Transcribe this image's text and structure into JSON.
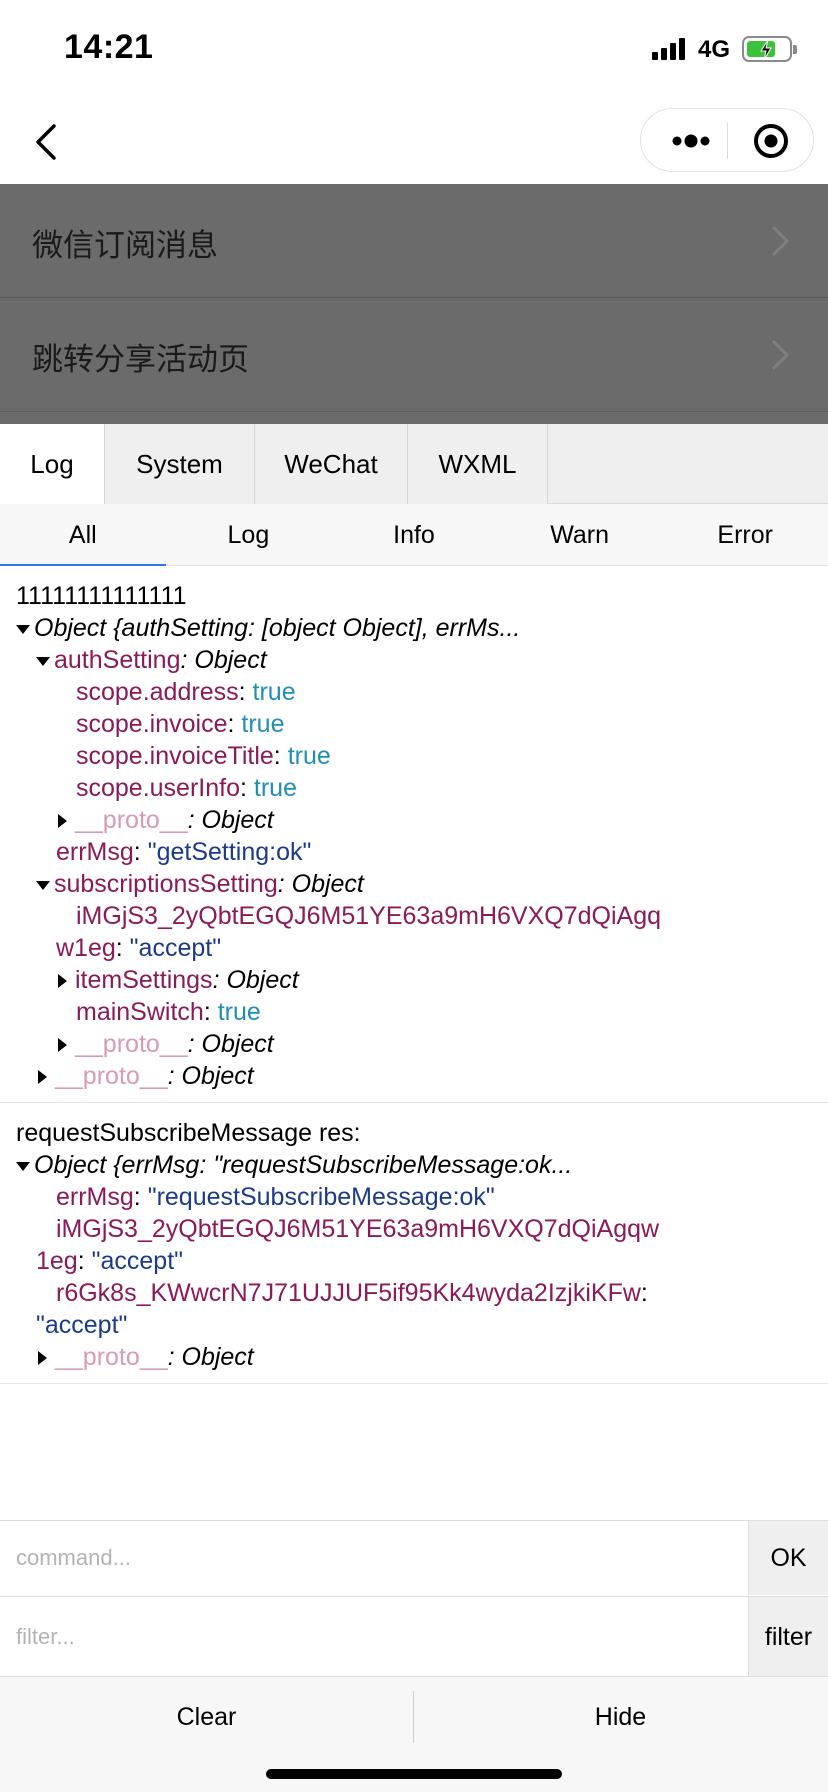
{
  "status_bar": {
    "time": "14:21",
    "network": "4G"
  },
  "page_items": [
    {
      "label": "微信订阅消息"
    },
    {
      "label": "跳转分享活动页"
    }
  ],
  "console_tabs": [
    "Log",
    "System",
    "WeChat",
    "WXML"
  ],
  "filter_tabs": [
    "All",
    "Log",
    "Info",
    "Warn",
    "Error"
  ],
  "log": {
    "e1": {
      "text": "11111111111111",
      "summary": "Object {authSetting: [object Object], errMs...",
      "authSetting_key": "authSetting",
      "authSetting_type": ": Object",
      "scope_address_key": "scope.address",
      "scope_address_val": "true",
      "scope_invoice_key": "scope.invoice",
      "scope_invoice_val": "true",
      "scope_invoiceTitle_key": "scope.invoiceTitle",
      "scope_invoiceTitle_val": "true",
      "scope_userInfo_key": "scope.userInfo",
      "scope_userInfo_val": "true",
      "proto_key": "__proto__",
      "proto_type": ": Object",
      "errMsg_key": "errMsg",
      "errMsg_val": "\"getSetting:ok\"",
      "subs_key": "subscriptionsSetting",
      "subs_type": ": Object",
      "tmpl_key_a": "iMGjS3_2yQbtEGQJ6M51YE63a9mH6VXQ7dQiAgq",
      "tmpl_key_b": "w1eg",
      "tmpl_val": "\"accept\"",
      "itemSettings_key": "itemSettings",
      "itemSettings_type": ": Object",
      "mainSwitch_key": "mainSwitch",
      "mainSwitch_val": "true",
      "sep": ": "
    },
    "e2": {
      "text": "requestSubscribeMessage res:",
      "summary": "Object {errMsg: \"requestSubscribeMessage:ok...",
      "errMsg_key": "errMsg",
      "errMsg_val": "\"requestSubscribeMessage:ok\"",
      "t1_key_a": "iMGjS3_2yQbtEGQJ6M51YE63a9mH6VXQ7dQiAgqw",
      "t1_key_b": "1eg",
      "t1_val": "\"accept\"",
      "t2_key": "r6Gk8s_KWwcrN7J71UJJUF5if95Kk4wyda2IzjkiKFw",
      "t2_val": "\"accept\"",
      "proto_key": "__proto__",
      "proto_type": ": Object"
    }
  },
  "command": {
    "placeholder": "command...",
    "button": "OK"
  },
  "filter": {
    "placeholder": "filter...",
    "button": "filter"
  },
  "bottom": {
    "clear": "Clear",
    "hide": "Hide"
  },
  "colors": {
    "accent": "#2a7be4",
    "key": "#8a1a5a",
    "string": "#1c3a8c",
    "boolean": "#1f8fb3",
    "battery": "#3cc13b"
  },
  "icons": [
    "signal-icon",
    "battery-icon",
    "back-icon",
    "more-icon",
    "target-icon",
    "chevron-right-icon",
    "triangle-down-icon",
    "triangle-right-icon"
  ]
}
